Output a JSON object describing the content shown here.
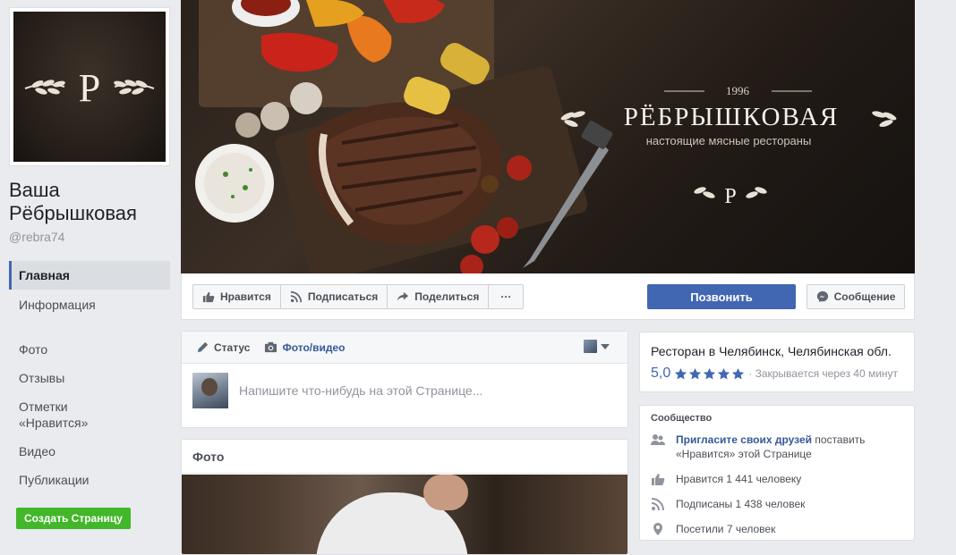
{
  "page": {
    "name": "Ваша Рёбрышковая",
    "handle": "@rebra74",
    "logo_letter": "P"
  },
  "nav": {
    "items": [
      {
        "label": "Главная"
      },
      {
        "label": "Информация"
      },
      {
        "label": "Фото"
      },
      {
        "label": "Отзывы"
      },
      {
        "label": "Отметки «Нравится»"
      },
      {
        "label": "Видео"
      },
      {
        "label": "Публикации"
      }
    ],
    "create_page": "Создать Страницу"
  },
  "cover": {
    "year": "1996",
    "brand": "РЁБРЫШКОВАЯ",
    "tagline": "настоящие мясные рестораны",
    "logo_letter": "P"
  },
  "actions": {
    "like": "Нравится",
    "follow": "Подписаться",
    "share": "Поделиться",
    "more": "···",
    "call": "Позвонить",
    "message": "Сообщение"
  },
  "composer": {
    "tab_status": "Статус",
    "tab_photo": "Фото/видео",
    "placeholder": "Напишите что-нибудь на этой Странице..."
  },
  "photos": {
    "title": "Фото"
  },
  "info": {
    "title": "Ресторан в Челябинск, Челябинская обл.",
    "rating": "5,0",
    "stars": 5,
    "closing": "· Закрывается через 40 минут"
  },
  "community": {
    "title": "Сообщество",
    "invite_link": "Пригласите своих друзей",
    "invite_rest": "поставить «Нравится» этой Странице",
    "likes": "Нравится 1 441 человеку",
    "followers": "Подписаны 1 438 человек",
    "visits": "Посетили 7 человек"
  },
  "colors": {
    "fb_blue": "#4267b2",
    "link_blue": "#365899",
    "green": "#42b72a",
    "background": "#e9ebee"
  }
}
